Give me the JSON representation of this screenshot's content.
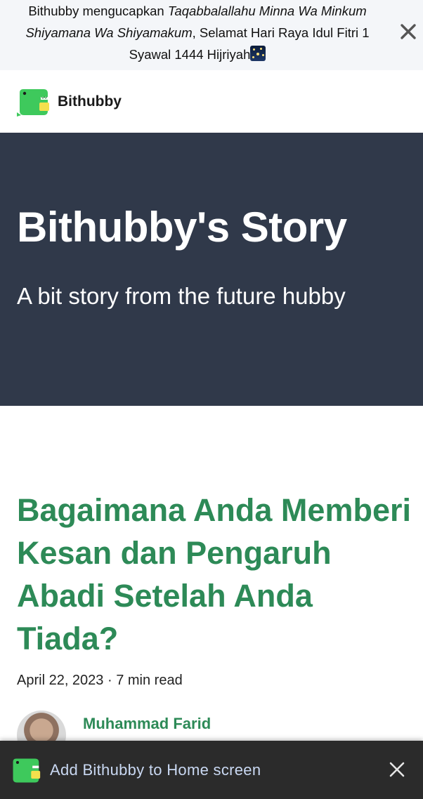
{
  "announcement": {
    "line1_prefix": "Bithubby mengucapkan ",
    "line1_italic": "Taqabbalallahu Minna Wa Minkum",
    "line2_italic": "Shiyamana Wa Shiyamakum",
    "line2_suffix": ", Selamat Hari Raya Idul Fitri 1",
    "line3": "Syawal 1444 Hijriyah",
    "emoji": "night-with-stars-icon",
    "close_icon": "close-icon"
  },
  "navbar": {
    "site_name": "Bithubby",
    "logo_icon": "crocodile-logo-icon"
  },
  "hero": {
    "title": "Bithubby's Story",
    "subtitle": "A bit story from the future hubby"
  },
  "post": {
    "title": "Bagaimana Anda Memberi Kesan dan Pengaruh Abadi Setelah Anda Tiada?",
    "date": "April 22, 2023",
    "separator": " · ",
    "read_time": "7 min read",
    "author": "Muhammad Farid"
  },
  "install_banner": {
    "text": "Add Bithubby to Home screen",
    "close_icon": "close-icon"
  },
  "colors": {
    "hero_bg": "#30394a",
    "accent_green": "#2d8a57",
    "banner_bg": "#2b2b2b",
    "announce_bg": "#f4f6f9"
  }
}
